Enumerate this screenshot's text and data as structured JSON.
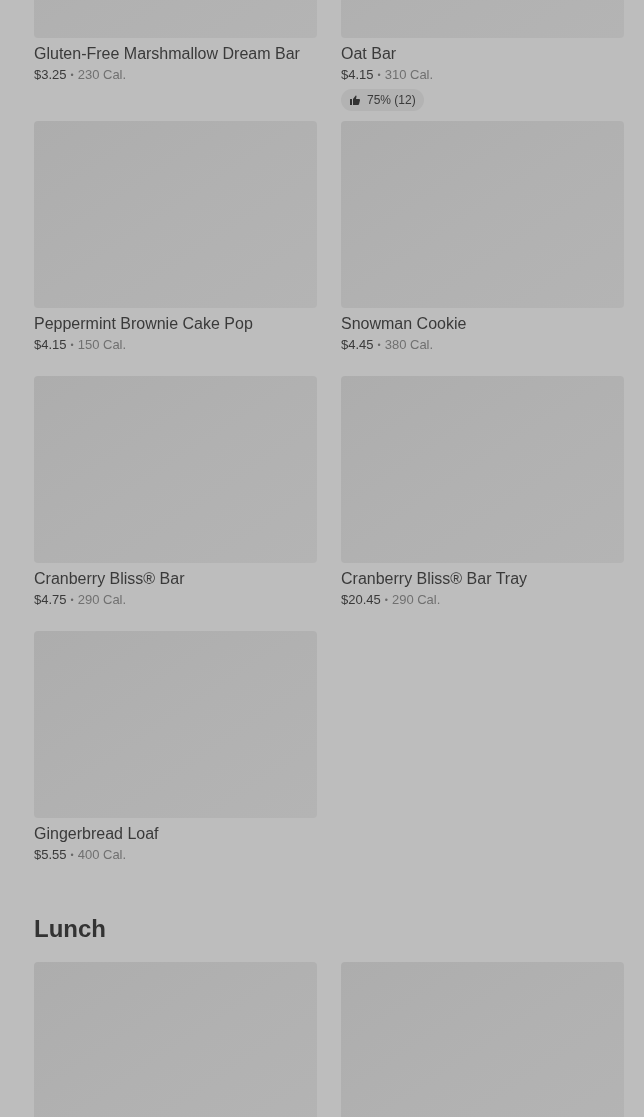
{
  "sections": [
    {
      "items": [
        {
          "kind": "product",
          "name": "Gluten-Free Marshmallow Dream Bar",
          "price": "$3.25",
          "separator": "•",
          "calories": "230 Cal."
        },
        {
          "kind": "product",
          "name": "Oat Bar",
          "price": "$4.15",
          "separator": "•",
          "calories": "310 Cal.",
          "rating": "75% (12)"
        },
        {
          "kind": "product",
          "name": "Peppermint Brownie Cake Pop",
          "price": "$4.15",
          "separator": "•",
          "calories": "150 Cal."
        },
        {
          "kind": "product",
          "name": "Snowman Cookie",
          "price": "$4.45",
          "separator": "•",
          "calories": "380 Cal."
        },
        {
          "kind": "product",
          "name": "Cranberry Bliss® Bar",
          "price": "$4.75",
          "separator": "•",
          "calories": "290 Cal."
        },
        {
          "kind": "product",
          "name": "Cranberry Bliss® Bar Tray",
          "price": "$20.45",
          "separator": "•",
          "calories": "290 Cal."
        },
        {
          "kind": "product",
          "name": "Gingerbread Loaf",
          "price": "$5.55",
          "separator": "•",
          "calories": "400 Cal."
        }
      ]
    },
    {
      "title": "Lunch",
      "items": [
        {
          "kind": "image_only"
        },
        {
          "kind": "image_only"
        }
      ]
    }
  ]
}
